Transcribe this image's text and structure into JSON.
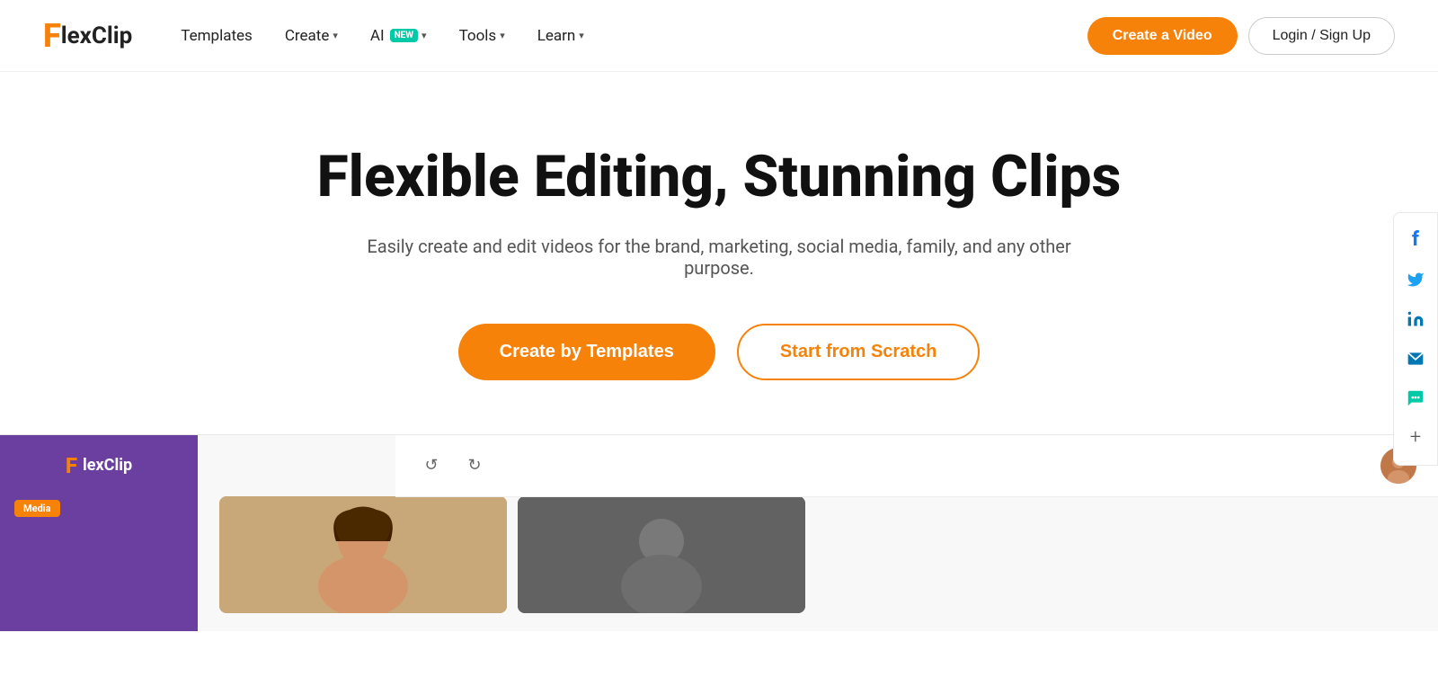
{
  "brand": {
    "name_f": "F",
    "name_rest": "lexClip"
  },
  "navbar": {
    "templates_label": "Templates",
    "create_label": "Create",
    "ai_label": "AI",
    "ai_badge": "NEW",
    "tools_label": "Tools",
    "learn_label": "Learn",
    "create_video_btn": "Create a Video",
    "login_btn": "Login / Sign Up"
  },
  "hero": {
    "title": "Flexible Editing, Stunning Clips",
    "subtitle": "Easily create and edit videos for the brand, marketing, social media, family, and any other purpose.",
    "btn_templates": "Create by Templates",
    "btn_scratch": "Start from Scratch"
  },
  "social": {
    "facebook": "f",
    "twitter": "t",
    "linkedin": "in",
    "email": "✉",
    "chat": "◎",
    "more": "+"
  },
  "editor_preview": {
    "logo_f": "F",
    "logo_rest": "lexClip",
    "media_label": "Media",
    "undo_icon": "↺",
    "redo_icon": "↻"
  }
}
